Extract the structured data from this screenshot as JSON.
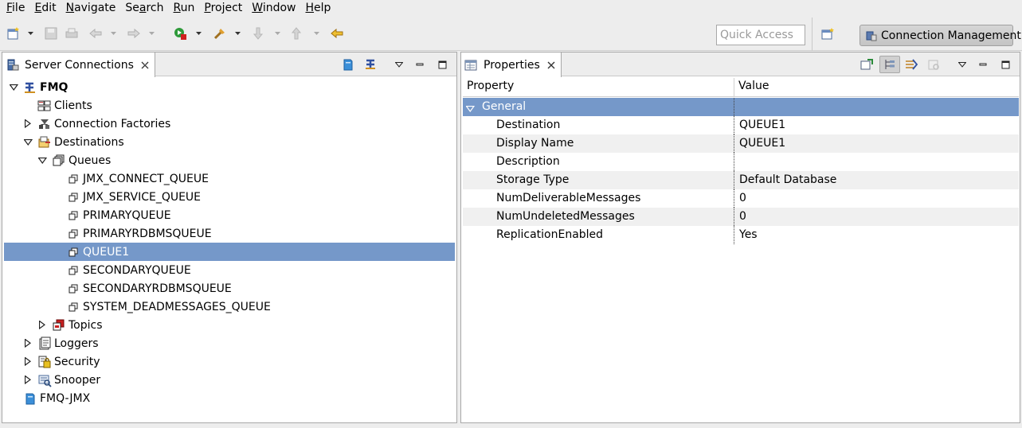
{
  "menu": [
    {
      "pre": "",
      "u": "F",
      "post": "ile"
    },
    {
      "pre": "",
      "u": "E",
      "post": "dit"
    },
    {
      "pre": "",
      "u": "N",
      "post": "avigate"
    },
    {
      "pre": "Se",
      "u": "a",
      "post": "rch"
    },
    {
      "pre": "",
      "u": "R",
      "post": "un"
    },
    {
      "pre": "",
      "u": "P",
      "post": "roject"
    },
    {
      "pre": "",
      "u": "W",
      "post": "indow"
    },
    {
      "pre": "",
      "u": "H",
      "post": "elp"
    }
  ],
  "toolbar": {
    "quick_access_placeholder": "Quick Access",
    "perspective_label": "Connection Management"
  },
  "server_connections": {
    "tab_label": "Server Connections",
    "tree": [
      {
        "label": "FMQ",
        "level": 0,
        "twist": "open",
        "icon": "fmq-server-icon",
        "bold": true
      },
      {
        "label": "Clients",
        "level": 1,
        "twist": "none",
        "icon": "clients-icon"
      },
      {
        "label": "Connection Factories",
        "level": 1,
        "twist": "closed",
        "icon": "connection-factories-icon"
      },
      {
        "label": "Destinations",
        "level": 1,
        "twist": "open",
        "icon": "destinations-icon"
      },
      {
        "label": "Queues",
        "level": 2,
        "twist": "open",
        "icon": "queues-icon"
      },
      {
        "label": "JMX_CONNECT_QUEUE",
        "level": 3,
        "twist": "none",
        "icon": "queue-icon"
      },
      {
        "label": "JMX_SERVICE_QUEUE",
        "level": 3,
        "twist": "none",
        "icon": "queue-icon"
      },
      {
        "label": "PRIMARYQUEUE",
        "level": 3,
        "twist": "none",
        "icon": "queue-icon"
      },
      {
        "label": "PRIMARYRDBMSQUEUE",
        "level": 3,
        "twist": "none",
        "icon": "queue-icon"
      },
      {
        "label": "QUEUE1",
        "level": 3,
        "twist": "none",
        "icon": "queue-icon",
        "selected": true
      },
      {
        "label": "SECONDARYQUEUE",
        "level": 3,
        "twist": "none",
        "icon": "queue-icon"
      },
      {
        "label": "SECONDARYRDBMSQUEUE",
        "level": 3,
        "twist": "none",
        "icon": "queue-icon"
      },
      {
        "label": "SYSTEM_DEADMESSAGES_QUEUE",
        "level": 3,
        "twist": "none",
        "icon": "queue-icon"
      },
      {
        "label": "Topics",
        "level": 2,
        "twist": "closed",
        "icon": "topics-icon"
      },
      {
        "label": "Loggers",
        "level": 1,
        "twist": "closed",
        "icon": "loggers-icon"
      },
      {
        "label": "Security",
        "level": 1,
        "twist": "closed",
        "icon": "security-icon"
      },
      {
        "label": "Snooper",
        "level": 1,
        "twist": "closed",
        "icon": "snooper-icon"
      },
      {
        "label": "FMQ-JMX",
        "level": 0,
        "twist": "none",
        "icon": "jmx-server-icon"
      }
    ]
  },
  "properties": {
    "tab_label": "Properties",
    "col_property": "Property",
    "col_value": "Value",
    "group_label": "General",
    "rows": [
      {
        "key": "Destination",
        "value": "QUEUE1"
      },
      {
        "key": "Display Name",
        "value": "QUEUE1"
      },
      {
        "key": "Description",
        "value": ""
      },
      {
        "key": "Storage Type",
        "value": "Default Database"
      },
      {
        "key": "NumDeliverableMessages",
        "value": "0"
      },
      {
        "key": "NumUndeletedMessages",
        "value": "0"
      },
      {
        "key": "ReplicationEnabled",
        "value": "Yes"
      }
    ]
  },
  "colors": {
    "selection": "#7598c9",
    "chrome": "#ededed",
    "border": "#a8a8a8"
  }
}
